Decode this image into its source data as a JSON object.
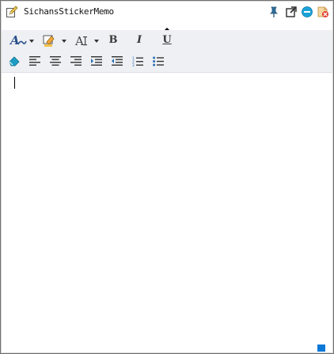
{
  "window": {
    "title": "SichansStickerMemo"
  },
  "titlebar_buttons": [
    "pin-icon",
    "popout-icon",
    "minimize-icon",
    "close-icon"
  ],
  "toolbar": {
    "row1": {
      "font_color": "font-color-icon",
      "highlight_color": "highlight-color-icon",
      "font_size": "font-size-icon",
      "bold": "B",
      "italic": "I",
      "underline": "U"
    },
    "row2": [
      "clear-format-icon",
      "align-left-icon",
      "align-center-icon",
      "align-right-icon",
      "indent-increase-icon",
      "indent-decrease-icon",
      "numbered-list-icon",
      "bullet-list-icon"
    ]
  },
  "editor": {
    "content": ""
  },
  "colors": {
    "accent": "#0a78d7",
    "toolbar_bg": "#eef0f3",
    "border": "#6f6f6f"
  }
}
